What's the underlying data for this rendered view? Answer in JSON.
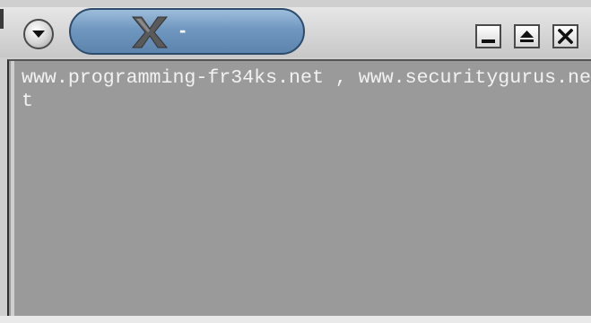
{
  "window": {
    "title": "-",
    "app_icon": "x-logo-icon"
  },
  "titlebar": {
    "menu_icon": "chevron-down-icon",
    "buttons": {
      "minimize_icon": "minimize-icon",
      "maximize_icon": "maximize-icon",
      "close_icon": "close-icon"
    }
  },
  "content": {
    "text": "www.programming-fr34ks.net , www.securitygurus.net"
  },
  "colors": {
    "title_tab": "#6f97bf",
    "content_bg": "#9a9a9a",
    "text": "#f2f2f2"
  }
}
